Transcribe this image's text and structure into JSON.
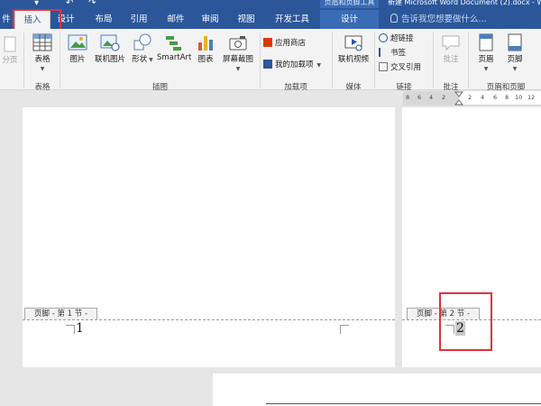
{
  "titlebar": {
    "contextual_group": "页眉和页脚工具",
    "document_title": "新建 Microsoft Word Document (2).docx - Word",
    "tell_me": "告诉我您想要做什么..."
  },
  "tabs": [
    {
      "label": "件"
    },
    {
      "label": "插入"
    },
    {
      "label": "设计"
    },
    {
      "label": "布局"
    },
    {
      "label": "引用"
    },
    {
      "label": "邮件"
    },
    {
      "label": "审阅"
    },
    {
      "label": "视图"
    },
    {
      "label": "开发工具"
    },
    {
      "label": "设计"
    }
  ],
  "ribbon": {
    "pages": {
      "blank_page": "分页"
    },
    "tables": {
      "table": "表格",
      "group": "表格"
    },
    "illustrations": {
      "picture": "图片",
      "online_picture": "联机图片",
      "shapes": "形状",
      "smartart": "SmartArt",
      "chart": "图表",
      "screenshot": "屏幕截图",
      "group": "插图"
    },
    "addins": {
      "store": "应用商店",
      "my_addins": "我的加载项",
      "group": "加载项"
    },
    "media": {
      "online_video": "联机视频",
      "group": "媒体"
    },
    "links": {
      "hyperlink": "超链接",
      "bookmark": "书签",
      "cross_reference": "交叉引用",
      "group": "链接"
    },
    "comments": {
      "comment": "批注",
      "group": "批注"
    },
    "header_footer": {
      "header": "页眉",
      "footer": "页脚",
      "group": "页眉和页脚"
    }
  },
  "ruler": {
    "marks": [
      "8",
      "6",
      "4",
      "2",
      "2",
      "4",
      "6",
      "8",
      "10",
      "12"
    ]
  },
  "pages": [
    {
      "footer_tag": "页脚 - 第 1 节 -",
      "page_number": "1"
    },
    {
      "footer_tag": "页脚 - 第 2 节 -",
      "page_number": "2"
    }
  ],
  "colors": {
    "accent": "#2b579a",
    "highlight": "#e0333a"
  }
}
